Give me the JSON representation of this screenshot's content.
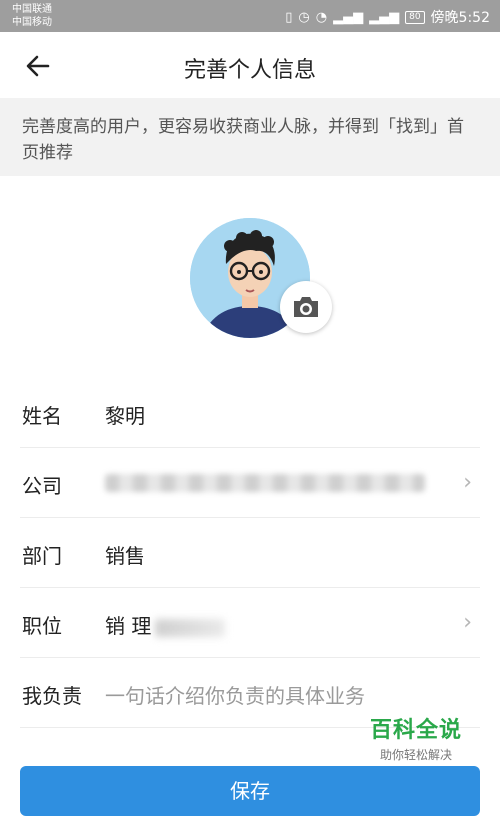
{
  "status_bar": {
    "carrier_1": "中国联通",
    "carrier_2": "中国移动",
    "battery": "80",
    "time": "傍晚5:52"
  },
  "header": {
    "title": "完善个人信息"
  },
  "notice": {
    "text": "完善度高的用户，更容易收获商业人脉，并得到「找到」首页推荐"
  },
  "form": {
    "name": {
      "label": "姓名",
      "value": "黎明"
    },
    "company": {
      "label": "公司",
      "value": ""
    },
    "department": {
      "label": "部门",
      "value": "销售"
    },
    "position": {
      "label": "职位",
      "value": "销  理"
    },
    "responsibility": {
      "label": "我负责",
      "placeholder": "一句话介绍你负责的具体业务"
    }
  },
  "watermark": {
    "title": "百科全说",
    "subtitle": "助你轻松解决"
  },
  "save_button": {
    "label": "保存"
  },
  "colors": {
    "accent": "#2f8fe0",
    "status_bar": "#9e9e9e",
    "notice_bg": "#f2f2f2",
    "watermark": "#2aa84a"
  }
}
